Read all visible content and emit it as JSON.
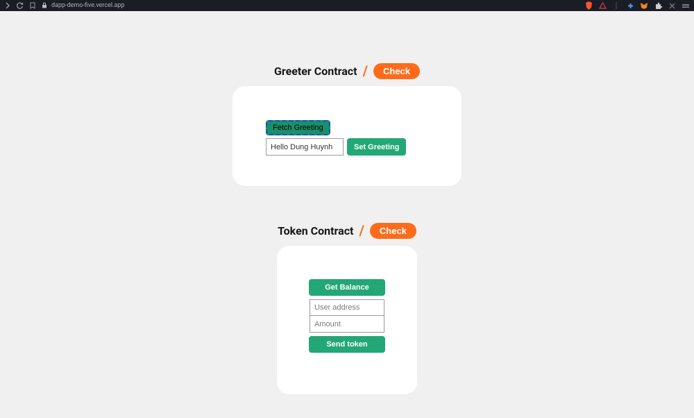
{
  "browser": {
    "url": "dapp-demo-five.vercel.app"
  },
  "greeter": {
    "title": "Greeter Contract",
    "check_label": "Check",
    "fetch_label": "Fetch Greeting",
    "set_label": "Set Greeting",
    "input_value": "Hello Dung Huynh"
  },
  "token": {
    "title": "Token Contract",
    "check_label": "Check",
    "balance_label": "Get Balance",
    "send_label": "Send token",
    "address_placeholder": "User address",
    "amount_placeholder": "Amount"
  }
}
